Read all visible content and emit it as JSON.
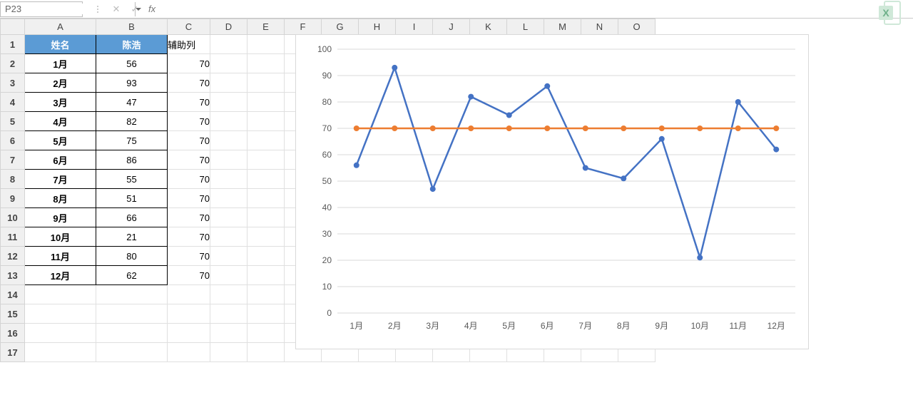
{
  "formula_bar": {
    "namebox_value": "P23",
    "cancel_icon": "✕",
    "confirm_icon": "✓",
    "fx_label": "fx",
    "fx_value": ""
  },
  "columns": [
    "A",
    "B",
    "C",
    "D",
    "E",
    "F",
    "G",
    "H",
    "I",
    "J",
    "K",
    "L",
    "M",
    "N",
    "O"
  ],
  "row_numbers": [
    1,
    2,
    3,
    4,
    5,
    6,
    7,
    8,
    9,
    10,
    11,
    12,
    13,
    14,
    15,
    16,
    17
  ],
  "table": {
    "headers": {
      "name": "姓名",
      "person": "陈浩",
      "aux": "辅助列"
    },
    "rows": [
      {
        "month": "1月",
        "value": 56,
        "aux": 70
      },
      {
        "month": "2月",
        "value": 93,
        "aux": 70
      },
      {
        "month": "3月",
        "value": 47,
        "aux": 70
      },
      {
        "month": "4月",
        "value": 82,
        "aux": 70
      },
      {
        "month": "5月",
        "value": 75,
        "aux": 70
      },
      {
        "month": "6月",
        "value": 86,
        "aux": 70
      },
      {
        "month": "7月",
        "value": 55,
        "aux": 70
      },
      {
        "month": "8月",
        "value": 51,
        "aux": 70
      },
      {
        "month": "9月",
        "value": 66,
        "aux": 70
      },
      {
        "month": "10月",
        "value": 21,
        "aux": 70
      },
      {
        "month": "11月",
        "value": 80,
        "aux": 70
      },
      {
        "month": "12月",
        "value": 62,
        "aux": 70
      }
    ]
  },
  "chart_data": {
    "type": "line",
    "categories": [
      "1月",
      "2月",
      "3月",
      "4月",
      "5月",
      "6月",
      "7月",
      "8月",
      "9月",
      "10月",
      "11月",
      "12月"
    ],
    "series": [
      {
        "name": "陈浩",
        "values": [
          56,
          93,
          47,
          82,
          75,
          86,
          55,
          51,
          66,
          21,
          80,
          62
        ],
        "color": "#4472c4"
      },
      {
        "name": "辅助列",
        "values": [
          70,
          70,
          70,
          70,
          70,
          70,
          70,
          70,
          70,
          70,
          70,
          70
        ],
        "color": "#ed7d31"
      }
    ],
    "ylim": [
      0,
      100
    ],
    "ytick_step": 10,
    "title": "",
    "xlabel": "",
    "ylabel": ""
  },
  "logo_label": "X"
}
